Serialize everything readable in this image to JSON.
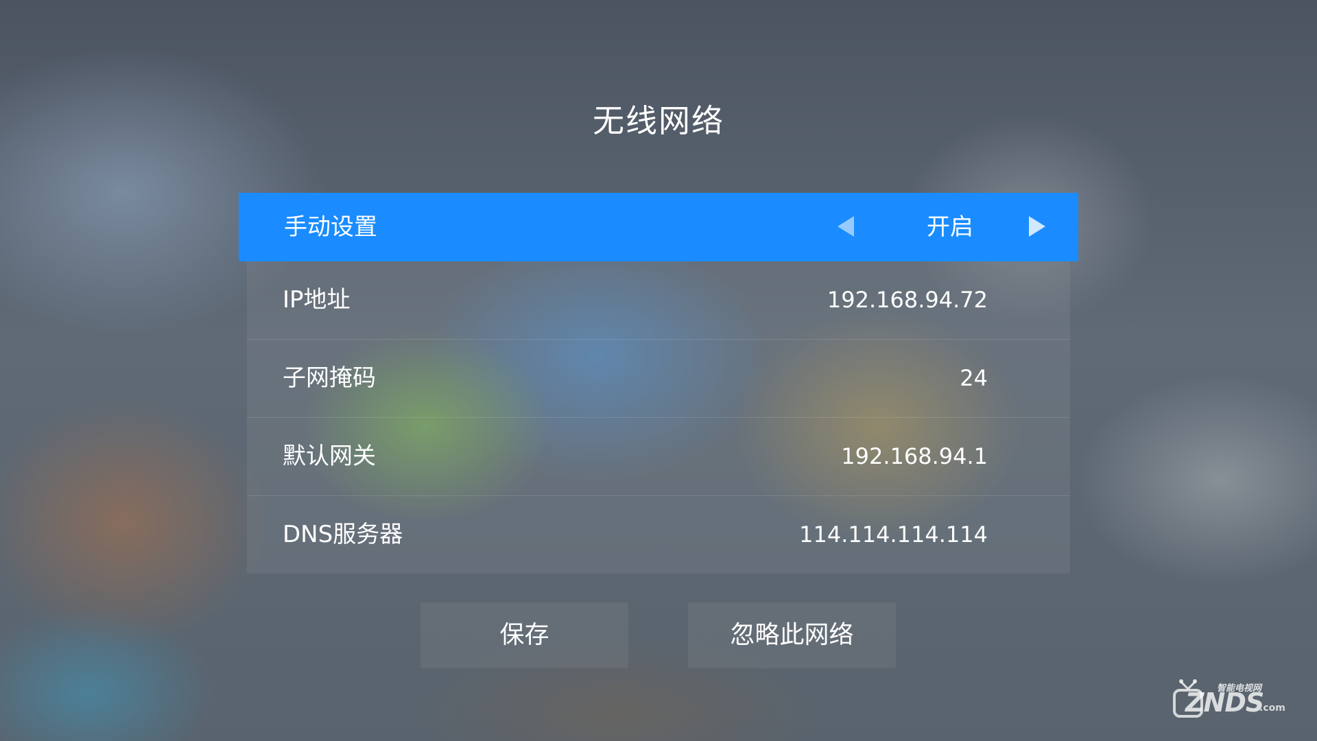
{
  "page": {
    "title": "无线网络"
  },
  "manual": {
    "label": "手动设置",
    "value": "开启"
  },
  "fields": [
    {
      "label": "IP地址",
      "value": "192.168.94.72"
    },
    {
      "label": "子网掩码",
      "value": "24"
    },
    {
      "label": "默认网关",
      "value": "192.168.94.1"
    },
    {
      "label": "DNS服务器",
      "value": "114.114.114.114"
    }
  ],
  "buttons": {
    "save": "保存",
    "forget": "忽略此网络"
  },
  "watermark": {
    "brand": "ZNDS",
    "suffix": ".com",
    "subtitle": "智能电视网"
  },
  "icons": {
    "left": "arrow-left-icon",
    "right": "arrow-right-icon",
    "logo": "tv-antenna-logo-icon"
  },
  "colors": {
    "accent": "#1a8cff"
  }
}
